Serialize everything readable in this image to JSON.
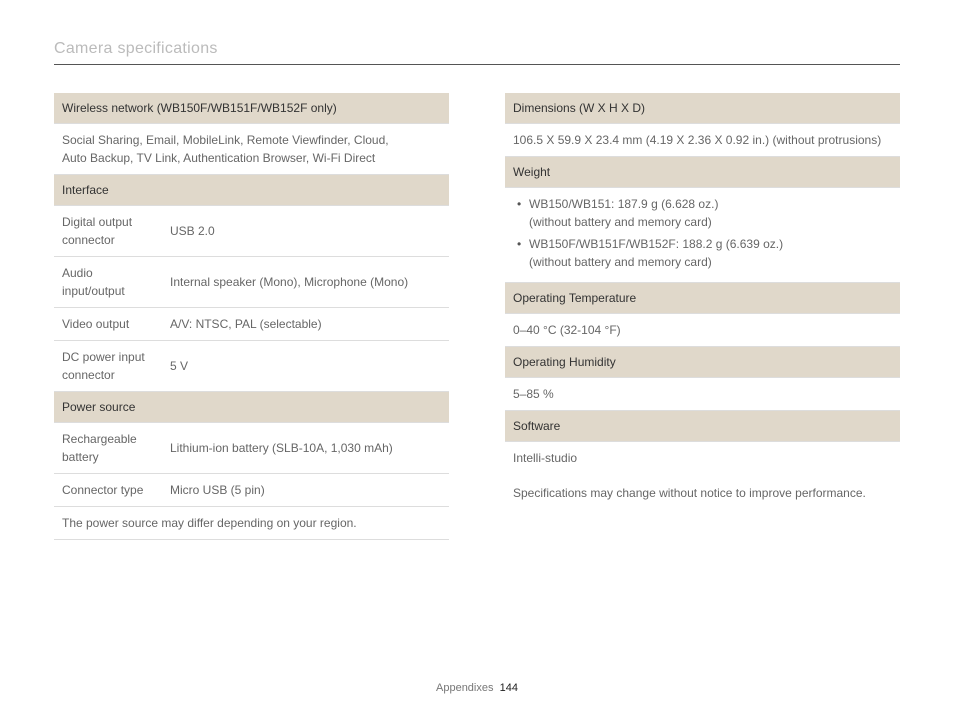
{
  "page_title": "Camera specifications",
  "footer": {
    "section": "Appendixes",
    "page_number": "144"
  },
  "left": {
    "sec1_header": "Wireless network (WB150F/WB151F/WB152F only)",
    "sec1_body_a": "Social Sharing, Email, MobileLink, Remote Viewfinder, Cloud,",
    "sec1_body_b": "Auto Backup, TV Link, Authentication Browser, Wi-Fi Direct",
    "sec2_header": "Interface",
    "rows": {
      "r1l": "Digital output connector",
      "r1v": "USB 2.0",
      "r2l": "Audio input/output",
      "r2v": "Internal speaker (Mono), Microphone (Mono)",
      "r3l": "Video output",
      "r3v": "A/V: NTSC, PAL (selectable)",
      "r4l": "DC power input connector",
      "r4v": "5 V"
    },
    "sec3_header": "Power source",
    "rows2": {
      "r1l": "Rechargeable battery",
      "r1v": "Lithium-ion battery (SLB-10A, 1,030 mAh)",
      "r2l": "Connector type",
      "r2v": "Micro USB (5 pin)"
    },
    "sec3_note": "The power source may differ depending on your region."
  },
  "right": {
    "sec1_header": "Dimensions (W X H X D)",
    "sec1_body": "106.5 X 59.9 X 23.4 mm (4.19 X 2.36 X 0.92 in.) (without protrusions)",
    "sec2_header": "Weight",
    "weight": {
      "i1a": "WB150/WB151: 187.9 g (6.628 oz.)",
      "i1b": "(without battery and memory card)",
      "i2a": "WB150F/WB151F/WB152F: 188.2 g (6.639 oz.)",
      "i2b": "(without battery and memory card)"
    },
    "sec3_header": "Operating Temperature",
    "sec3_body": "0–40 °C (32-104 °F)",
    "sec4_header": "Operating Humidity",
    "sec4_body": "5–85 %",
    "sec5_header": "Software",
    "sec5_body": "Intelli-studio",
    "footnote": "Specifications may change without notice to improve performance."
  }
}
